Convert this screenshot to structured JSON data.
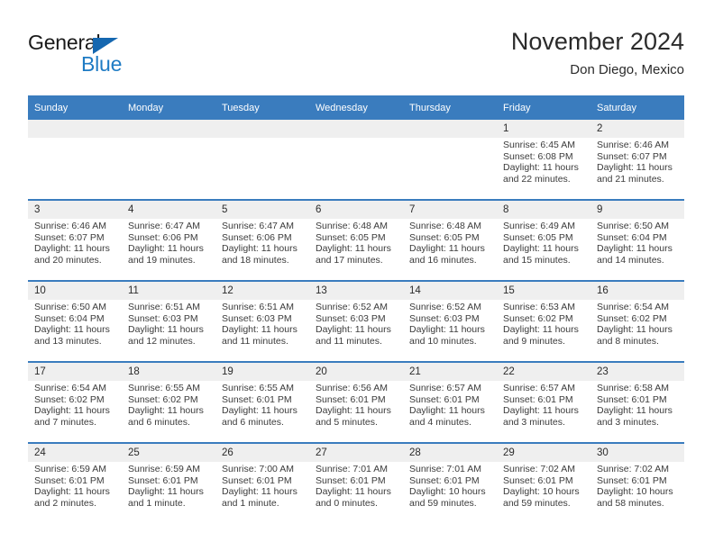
{
  "brand": {
    "word_one": "General",
    "word_two": "Blue",
    "triangle_color": "#1567b0",
    "blue_color": "#1e7bc4"
  },
  "header": {
    "title": "November 2024",
    "location": "Don Diego, Mexico"
  },
  "theme": {
    "header_bg": "#3a7cbe",
    "header_text": "#ffffff",
    "daynum_bg": "#efefef",
    "row_divider": "#3a7cbe"
  },
  "weekdays": [
    "Sunday",
    "Monday",
    "Tuesday",
    "Wednesday",
    "Thursday",
    "Friday",
    "Saturday"
  ],
  "weeks": [
    [
      {
        "day": "",
        "empty": true
      },
      {
        "day": "",
        "empty": true
      },
      {
        "day": "",
        "empty": true
      },
      {
        "day": "",
        "empty": true
      },
      {
        "day": "",
        "empty": true
      },
      {
        "day": "1",
        "sunrise": "Sunrise: 6:45 AM",
        "sunset": "Sunset: 6:08 PM",
        "daylight1": "Daylight: 11 hours",
        "daylight2": "and 22 minutes."
      },
      {
        "day": "2",
        "sunrise": "Sunrise: 6:46 AM",
        "sunset": "Sunset: 6:07 PM",
        "daylight1": "Daylight: 11 hours",
        "daylight2": "and 21 minutes."
      }
    ],
    [
      {
        "day": "3",
        "sunrise": "Sunrise: 6:46 AM",
        "sunset": "Sunset: 6:07 PM",
        "daylight1": "Daylight: 11 hours",
        "daylight2": "and 20 minutes."
      },
      {
        "day": "4",
        "sunrise": "Sunrise: 6:47 AM",
        "sunset": "Sunset: 6:06 PM",
        "daylight1": "Daylight: 11 hours",
        "daylight2": "and 19 minutes."
      },
      {
        "day": "5",
        "sunrise": "Sunrise: 6:47 AM",
        "sunset": "Sunset: 6:06 PM",
        "daylight1": "Daylight: 11 hours",
        "daylight2": "and 18 minutes."
      },
      {
        "day": "6",
        "sunrise": "Sunrise: 6:48 AM",
        "sunset": "Sunset: 6:05 PM",
        "daylight1": "Daylight: 11 hours",
        "daylight2": "and 17 minutes."
      },
      {
        "day": "7",
        "sunrise": "Sunrise: 6:48 AM",
        "sunset": "Sunset: 6:05 PM",
        "daylight1": "Daylight: 11 hours",
        "daylight2": "and 16 minutes."
      },
      {
        "day": "8",
        "sunrise": "Sunrise: 6:49 AM",
        "sunset": "Sunset: 6:05 PM",
        "daylight1": "Daylight: 11 hours",
        "daylight2": "and 15 minutes."
      },
      {
        "day": "9",
        "sunrise": "Sunrise: 6:50 AM",
        "sunset": "Sunset: 6:04 PM",
        "daylight1": "Daylight: 11 hours",
        "daylight2": "and 14 minutes."
      }
    ],
    [
      {
        "day": "10",
        "sunrise": "Sunrise: 6:50 AM",
        "sunset": "Sunset: 6:04 PM",
        "daylight1": "Daylight: 11 hours",
        "daylight2": "and 13 minutes."
      },
      {
        "day": "11",
        "sunrise": "Sunrise: 6:51 AM",
        "sunset": "Sunset: 6:03 PM",
        "daylight1": "Daylight: 11 hours",
        "daylight2": "and 12 minutes."
      },
      {
        "day": "12",
        "sunrise": "Sunrise: 6:51 AM",
        "sunset": "Sunset: 6:03 PM",
        "daylight1": "Daylight: 11 hours",
        "daylight2": "and 11 minutes."
      },
      {
        "day": "13",
        "sunrise": "Sunrise: 6:52 AM",
        "sunset": "Sunset: 6:03 PM",
        "daylight1": "Daylight: 11 hours",
        "daylight2": "and 11 minutes."
      },
      {
        "day": "14",
        "sunrise": "Sunrise: 6:52 AM",
        "sunset": "Sunset: 6:03 PM",
        "daylight1": "Daylight: 11 hours",
        "daylight2": "and 10 minutes."
      },
      {
        "day": "15",
        "sunrise": "Sunrise: 6:53 AM",
        "sunset": "Sunset: 6:02 PM",
        "daylight1": "Daylight: 11 hours",
        "daylight2": "and 9 minutes."
      },
      {
        "day": "16",
        "sunrise": "Sunrise: 6:54 AM",
        "sunset": "Sunset: 6:02 PM",
        "daylight1": "Daylight: 11 hours",
        "daylight2": "and 8 minutes."
      }
    ],
    [
      {
        "day": "17",
        "sunrise": "Sunrise: 6:54 AM",
        "sunset": "Sunset: 6:02 PM",
        "daylight1": "Daylight: 11 hours",
        "daylight2": "and 7 minutes."
      },
      {
        "day": "18",
        "sunrise": "Sunrise: 6:55 AM",
        "sunset": "Sunset: 6:02 PM",
        "daylight1": "Daylight: 11 hours",
        "daylight2": "and 6 minutes."
      },
      {
        "day": "19",
        "sunrise": "Sunrise: 6:55 AM",
        "sunset": "Sunset: 6:01 PM",
        "daylight1": "Daylight: 11 hours",
        "daylight2": "and 6 minutes."
      },
      {
        "day": "20",
        "sunrise": "Sunrise: 6:56 AM",
        "sunset": "Sunset: 6:01 PM",
        "daylight1": "Daylight: 11 hours",
        "daylight2": "and 5 minutes."
      },
      {
        "day": "21",
        "sunrise": "Sunrise: 6:57 AM",
        "sunset": "Sunset: 6:01 PM",
        "daylight1": "Daylight: 11 hours",
        "daylight2": "and 4 minutes."
      },
      {
        "day": "22",
        "sunrise": "Sunrise: 6:57 AM",
        "sunset": "Sunset: 6:01 PM",
        "daylight1": "Daylight: 11 hours",
        "daylight2": "and 3 minutes."
      },
      {
        "day": "23",
        "sunrise": "Sunrise: 6:58 AM",
        "sunset": "Sunset: 6:01 PM",
        "daylight1": "Daylight: 11 hours",
        "daylight2": "and 3 minutes."
      }
    ],
    [
      {
        "day": "24",
        "sunrise": "Sunrise: 6:59 AM",
        "sunset": "Sunset: 6:01 PM",
        "daylight1": "Daylight: 11 hours",
        "daylight2": "and 2 minutes."
      },
      {
        "day": "25",
        "sunrise": "Sunrise: 6:59 AM",
        "sunset": "Sunset: 6:01 PM",
        "daylight1": "Daylight: 11 hours",
        "daylight2": "and 1 minute."
      },
      {
        "day": "26",
        "sunrise": "Sunrise: 7:00 AM",
        "sunset": "Sunset: 6:01 PM",
        "daylight1": "Daylight: 11 hours",
        "daylight2": "and 1 minute."
      },
      {
        "day": "27",
        "sunrise": "Sunrise: 7:01 AM",
        "sunset": "Sunset: 6:01 PM",
        "daylight1": "Daylight: 11 hours",
        "daylight2": "and 0 minutes."
      },
      {
        "day": "28",
        "sunrise": "Sunrise: 7:01 AM",
        "sunset": "Sunset: 6:01 PM",
        "daylight1": "Daylight: 10 hours",
        "daylight2": "and 59 minutes."
      },
      {
        "day": "29",
        "sunrise": "Sunrise: 7:02 AM",
        "sunset": "Sunset: 6:01 PM",
        "daylight1": "Daylight: 10 hours",
        "daylight2": "and 59 minutes."
      },
      {
        "day": "30",
        "sunrise": "Sunrise: 7:02 AM",
        "sunset": "Sunset: 6:01 PM",
        "daylight1": "Daylight: 10 hours",
        "daylight2": "and 58 minutes."
      }
    ]
  ]
}
